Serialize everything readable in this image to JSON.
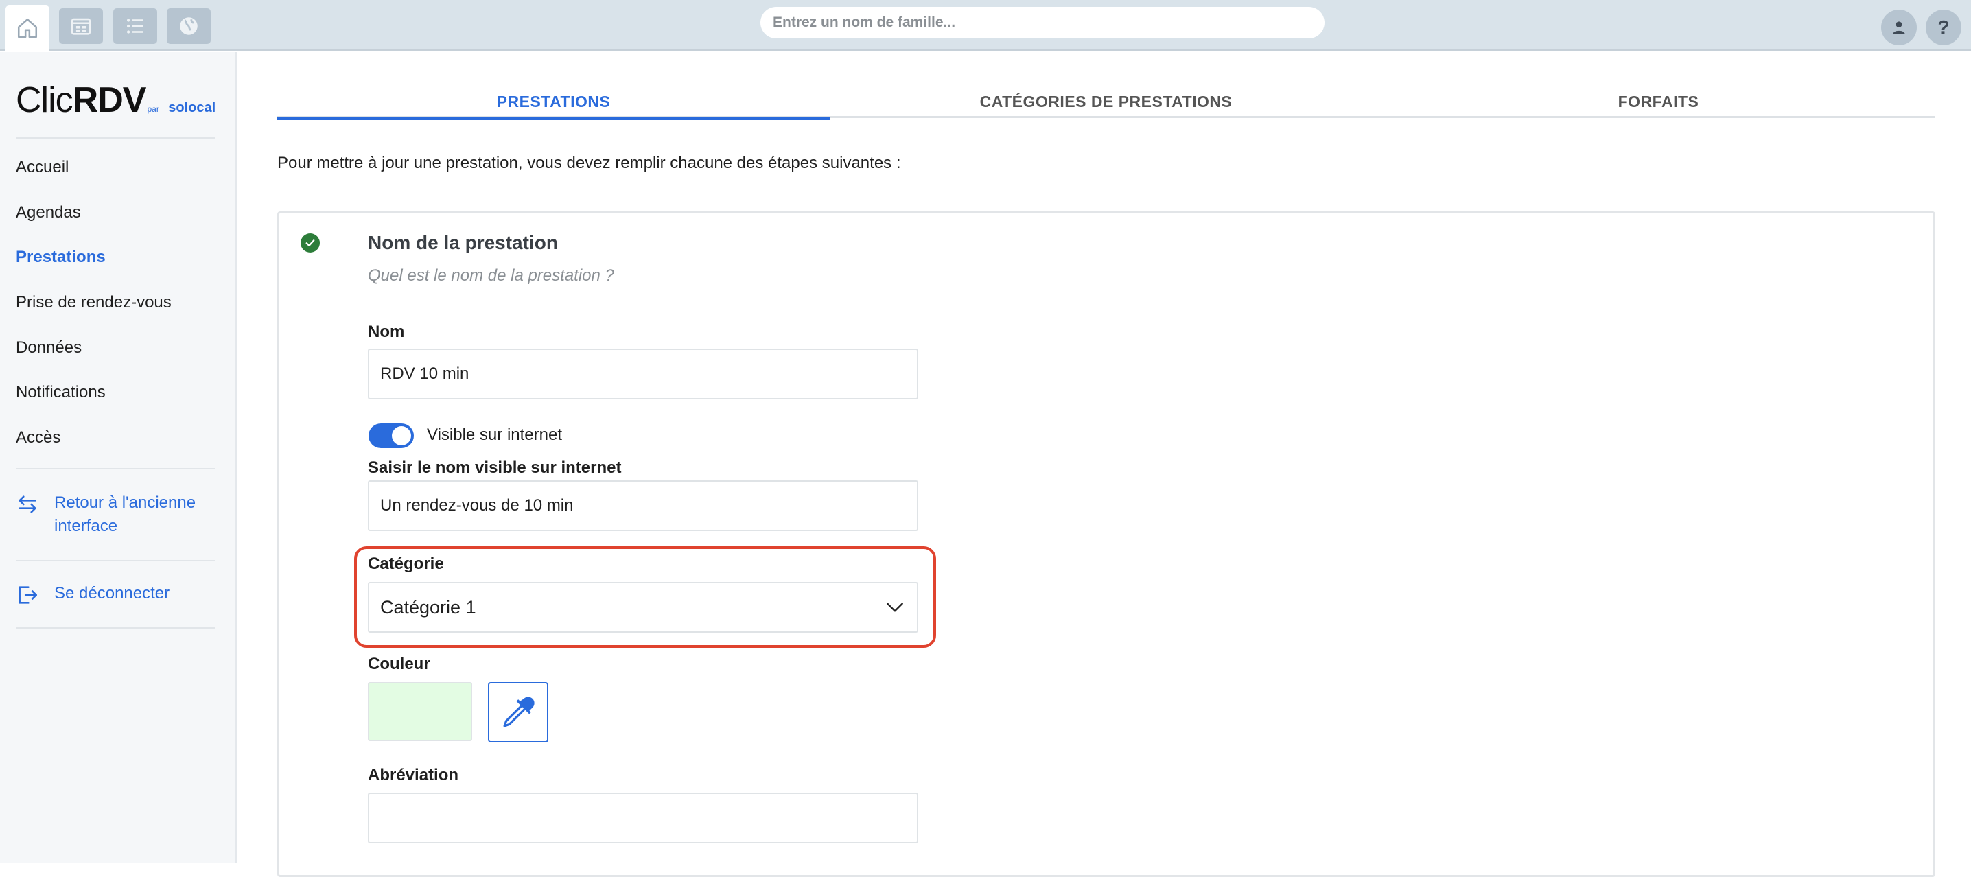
{
  "topbar": {
    "search_placeholder": "Entrez un nom de famille...",
    "help_label": "?",
    "icons": [
      "home-icon",
      "calendar-icon",
      "list-icon",
      "globe-icon",
      "user-icon"
    ]
  },
  "sidebar": {
    "logo": {
      "clic": "Clic",
      "rdv": "RDV",
      "par": "par",
      "brand": "solocal"
    },
    "nav": [
      {
        "label": "Accueil",
        "active": false
      },
      {
        "label": "Agendas",
        "active": false
      },
      {
        "label": "Prestations",
        "active": true
      },
      {
        "label": "Prise de rendez-vous",
        "active": false
      },
      {
        "label": "Données",
        "active": false
      },
      {
        "label": "Notifications",
        "active": false
      },
      {
        "label": "Accès",
        "active": false
      }
    ],
    "links": {
      "old_interface": "Retour à l'ancienne interface",
      "logout": "Se déconnecter"
    }
  },
  "tabs": [
    {
      "label": "PRESTATIONS",
      "active": true
    },
    {
      "label": "CATÉGORIES DE PRESTATIONS",
      "active": false
    },
    {
      "label": "FORFAITS",
      "active": false
    }
  ],
  "intro": "Pour mettre à jour une prestation, vous devez remplir chacune des étapes suivantes :",
  "step": {
    "title": "Nom de la prestation",
    "subtitle": "Quel est le nom de la prestation ?",
    "status": "completed"
  },
  "form": {
    "nom_label": "Nom",
    "nom_value": "RDV 10 min",
    "visible_toggle_label": "Visible sur internet",
    "visible_toggle_on": true,
    "internet_name_label": "Saisir le nom visible sur internet",
    "internet_name_value": "Un rendez-vous de 10 min",
    "categorie_label": "Catégorie",
    "categorie_value": "Catégorie 1",
    "couleur_label": "Couleur",
    "couleur_value": "#e3fce3",
    "abreviation_label": "Abréviation",
    "abreviation_value": ""
  },
  "colors": {
    "accent": "#2a6bdc",
    "highlight": "#e0432f",
    "success": "#2d7d3a"
  }
}
